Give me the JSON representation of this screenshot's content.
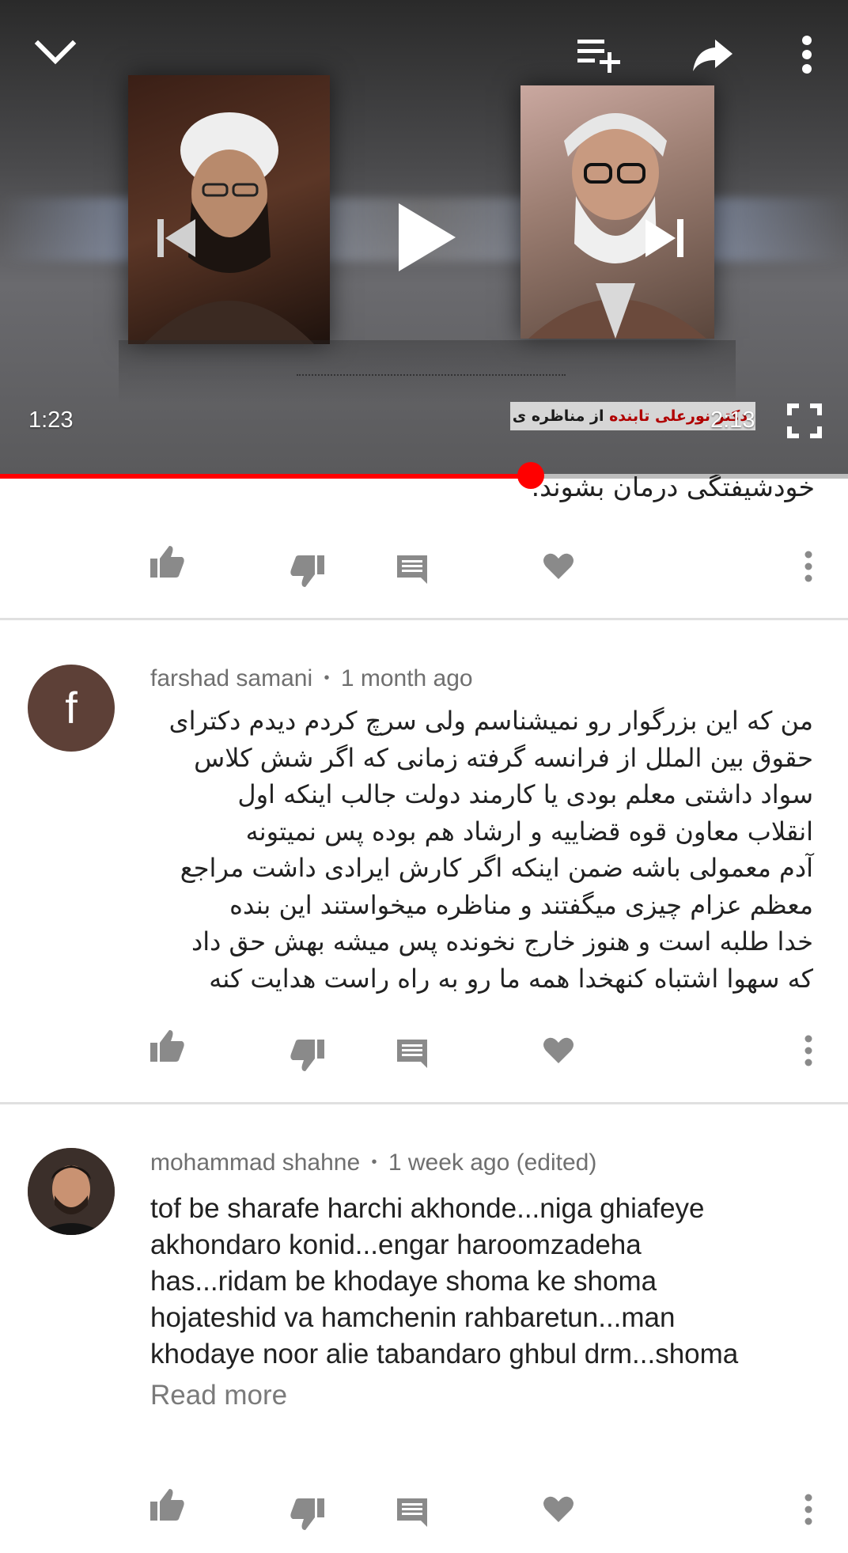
{
  "player": {
    "current_time": "1:23",
    "duration": "2:13",
    "progress_fraction": 0.624,
    "caption_prefix": "دکتر نورعلی تابنده",
    "caption_rest": " از مناظره ی علمی",
    "icons": [
      "chevron-down-icon",
      "add-to-queue-icon",
      "share-icon",
      "more-vert-icon",
      "skip-previous-icon",
      "play-icon",
      "skip-next-icon",
      "fullscreen-icon"
    ]
  },
  "comments": [
    {
      "clipped_text": "خودشیفتگی درمان بشوند."
    },
    {
      "avatar_letter": "f",
      "author": "farshad samani",
      "separator": "•",
      "time": "1 month ago",
      "lines": [
        "من که این بزرگوار رو نمیشناسم ولی سرچ کردم دیدم دکترای",
        "حقوق بین الملل از فرانسه گرفته زمانی که اگر شش کلاس",
        "سواد داشتی معلم بودی یا کارمند دولت جالب اینکه اول",
        "انقلاب معاون قوه قضاییه و ارشاد هم بوده پس نمیتونه",
        "آدم معمولی باشه ضمن اینکه اگر کارش ایرادی داشت مراجع",
        "معظم عزام چیزی میگفتند و مناظره میخواستند این بنده",
        "خدا طلبه است و هنوز خارج نخونده پس میشه بهش حق داد",
        "که سهوا اشتباه کنهخدا همه ما رو به راه راست هدایت کنه"
      ]
    },
    {
      "author": "mohammad shahne",
      "separator": "•",
      "time": "1 week ago (edited)",
      "lines": [
        "tof be sharafe harchi akhonde...niga ghiafeye",
        "akhondaro konid...engar haroomzadeha",
        "has...ridam be khodaye shoma ke shoma",
        "hojateshid va hamchenin rahbaretun...man",
        "khodaye noor alie tabandaro ghbul drm...shoma"
      ],
      "read_more": "Read more"
    }
  ],
  "action_icons": [
    "like-icon",
    "dislike-icon",
    "reply-icon",
    "heart-icon",
    "more-vert-icon"
  ],
  "colors": {
    "progress": "#ff0000",
    "avatar_f": "#5d4037",
    "meta_text": "#6f6f6f",
    "action_icon": "#8a8a8a"
  }
}
